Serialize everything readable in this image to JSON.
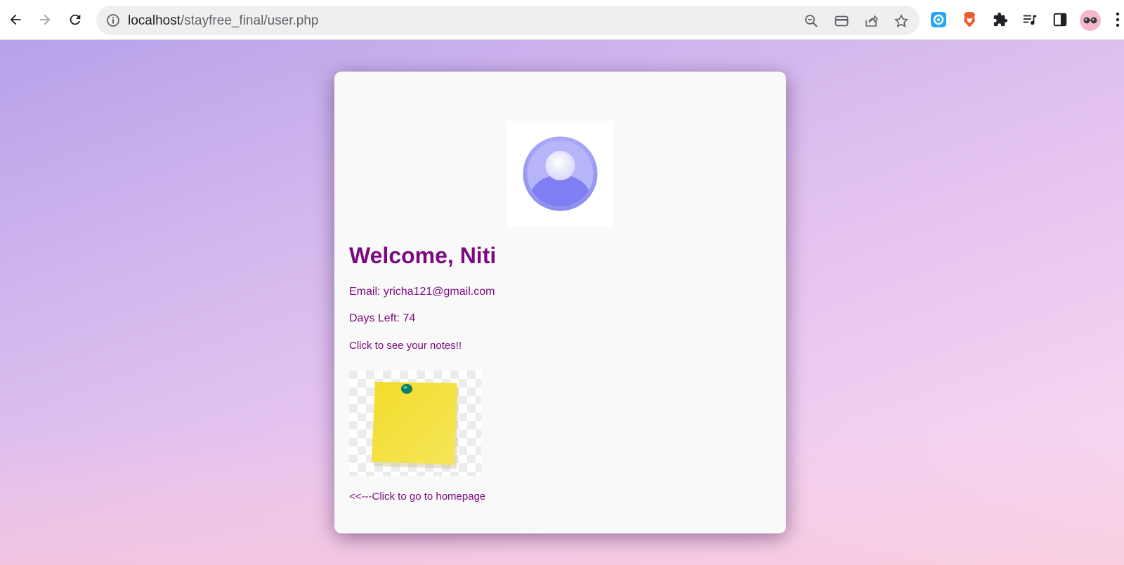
{
  "browser": {
    "url_host": "localhost",
    "url_path": "/stayfree_final/user.php"
  },
  "colors": {
    "accent": "#7a0a7e",
    "card_bg": "#f9f9f9"
  },
  "profile": {
    "welcome": "Welcome, Niti",
    "email": "Email: yricha121@gmail.com",
    "days_left": "Days Left: 74",
    "notes_link": "Click to see your notes!!",
    "home_link": "<<---Click to go to homepage"
  },
  "icons": {
    "back": "arrow-left-icon",
    "forward": "arrow-right-icon",
    "reload": "reload-icon",
    "info": "info-icon",
    "zoom": "zoom-icon",
    "card": "card-icon",
    "share": "share-icon",
    "star": "star-icon",
    "ext1": "extension-blue-icon",
    "brave": "brave-lion-icon",
    "puzzle": "puzzle-icon",
    "playlist": "playlist-icon",
    "sidepanel": "side-panel-icon",
    "avatar": "profile-avatar-icon",
    "menu": "kebab-menu-icon"
  }
}
